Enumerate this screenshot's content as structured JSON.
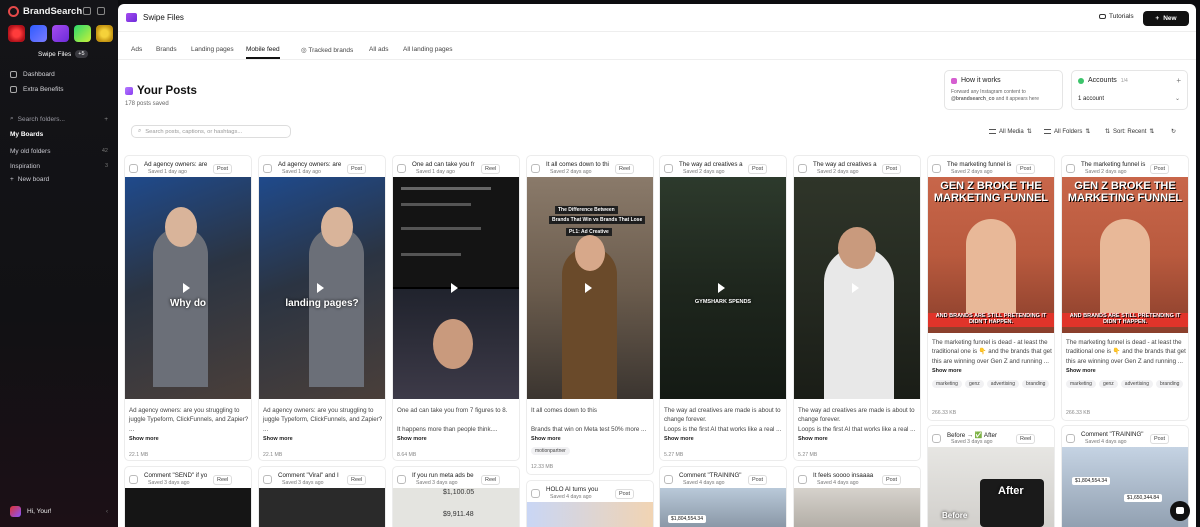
{
  "app": {
    "name": "BrandSearch"
  },
  "sidebar": {
    "workspace_label": "Swipe Files",
    "workspace_count": "+5",
    "nav": [
      {
        "label": "Dashboard"
      },
      {
        "label": "Extra Benefits"
      }
    ],
    "search_placeholder": "Search folders...",
    "boards_header": "My Boards",
    "folders": [
      {
        "label": "My old folders",
        "count": "42"
      },
      {
        "label": "Inspiration",
        "count": "3"
      }
    ],
    "new_board": "New board",
    "user": "Hi, Your!"
  },
  "header": {
    "title": "Swipe Files",
    "tutorials": "Tutorials",
    "new_button": "New"
  },
  "tabs": [
    {
      "label": "Ads"
    },
    {
      "label": "Brands"
    },
    {
      "label": "Landing pages"
    },
    {
      "label": "Mobile feed"
    },
    {
      "label": "Tracked brands"
    },
    {
      "label": "All ads"
    },
    {
      "label": "All landing pages"
    }
  ],
  "page": {
    "title": "Your Posts",
    "subtitle": "178 posts saved"
  },
  "how_it_works": {
    "title": "How it works",
    "line1": "Forward any Instagram content to",
    "handle": "@brandsearch_co",
    "line2": "and it appears here"
  },
  "accounts": {
    "title": "Accounts",
    "count": "1/4",
    "selected": "1 account"
  },
  "toolbar": {
    "search_placeholder": "Search posts, captions, or hashtags...",
    "media_filter": "All Media",
    "folder_filter": "All Folders",
    "sort": "Sort: Recent"
  },
  "cards": [
    {
      "title": "Ad agency owners: are",
      "date": "Saved 1 day ago",
      "badge": "Post",
      "overlay": "Why do",
      "caption": "Ad agency owners: are you struggling to juggle Typeform, ClickFunnels, and Zapier?",
      "caption2": "...",
      "more": "Show more",
      "size": "22.1 MB"
    },
    {
      "title": "Ad agency owners: are",
      "date": "Saved 1 day ago",
      "badge": "Post",
      "overlay": "landing pages?",
      "caption": "Ad agency owners: are you struggling to juggle Typeform, ClickFunnels, and Zapier?",
      "caption2": "...",
      "more": "Show more",
      "size": "22.1 MB"
    },
    {
      "title": "One ad can take you fr",
      "date": "Saved 1 day ago",
      "badge": "Reel",
      "caption": "One ad can take you from 7 figures to 8.",
      "caption2": "It happens more than people think....",
      "more": "Show more",
      "size": "8.64 MB"
    },
    {
      "title": "It all comes down to thi",
      "date": "Saved 2 days ago",
      "badge": "Reel",
      "overlay_top": "The Difference Between",
      "overlay_mid": "Brands That Win vs Brands That Lose",
      "overlay_pt": "Pt.1: Ad Creative",
      "caption": "It all comes down to this",
      "caption2": "Brands that win on Meta test 50% more ...",
      "more": "Show more",
      "tags": [
        "motionpartner"
      ],
      "size": "12.33 MB"
    },
    {
      "title": "The way ad creatives a",
      "date": "Saved 2 days ago",
      "badge": "Post",
      "overlay": "GYMSHARK SPENDS",
      "caption": "The way ad creatives are made is about to change forever.",
      "caption2": "Loops is the first AI that works like a real ...",
      "more": "Show more",
      "size": "5.27 MB"
    },
    {
      "title": "The way ad creatives a",
      "date": "Saved 2 days ago",
      "badge": "Post",
      "caption": "The way ad creatives are made is about to change forever.",
      "caption2": "Loops is the first AI that works like a real ...",
      "more": "Show more",
      "size": "5.27 MB"
    },
    {
      "title": "The marketing funnel is",
      "date": "Saved 2 days ago",
      "badge": "Post",
      "overlay_top": "GEN Z BROKE THE MARKETING FUNNEL",
      "overlay_bottom": "AND BRANDS ARE STILL PRETENDING IT DIDN'T HAPPEN.",
      "caption": "The marketing funnel is dead - at least the traditional one is 👇 and the brands that get this are winning over Gen Z and running ...",
      "more": "Show more",
      "tags": [
        "marketing",
        "genz",
        "advertising",
        "branding"
      ],
      "size": "266.33 KB"
    },
    {
      "title": "The marketing funnel is",
      "date": "Saved 2 days ago",
      "badge": "Post",
      "overlay_top": "GEN Z BROKE THE MARKETING FUNNEL",
      "overlay_bottom": "AND BRANDS ARE STILL PRETENDING IT DIDN'T HAPPEN.",
      "caption": "The marketing funnel is dead - at least the traditional one is 👇 and the brands that get this are winning over Gen Z and running ...",
      "more": "Show more",
      "tags": [
        "marketing",
        "genz",
        "advertising",
        "branding"
      ],
      "size": "266.33 KB"
    }
  ],
  "cards_row2": [
    {
      "title": "Comment \"SEND\" if yo",
      "date": "Saved 3 days ago",
      "badge": "Reel"
    },
    {
      "title": "Comment \"Viral\" and I",
      "date": "Saved 3 days ago",
      "badge": "Reel"
    },
    {
      "title": "If you run meta ads be",
      "date": "Saved 3 days ago",
      "badge": "Reel",
      "v1": "$1,100.05",
      "v2": "$9,911.48"
    },
    {
      "title": "HOLO AI turns you",
      "date": "Saved 4 days ago",
      "badge": "Post"
    },
    {
      "title": "Comment \"TRAINING\"",
      "date": "Saved 4 days ago",
      "badge": "Post",
      "v1": "$1,804,554.34"
    },
    {
      "title": "It feels soooo insaaaa",
      "date": "Saved 4 days ago",
      "badge": "Post"
    },
    {
      "title": "Before → ✅ After",
      "date": "Saved 3 days ago",
      "badge": "Reel",
      "overlay": "After",
      "overlay2": "Before"
    },
    {
      "title": "Comment \"TRAINING\"",
      "date": "Saved 4 days ago",
      "badge": "Post",
      "v1": "$1,804,554.34",
      "v2": "$1,650,344.84"
    }
  ]
}
